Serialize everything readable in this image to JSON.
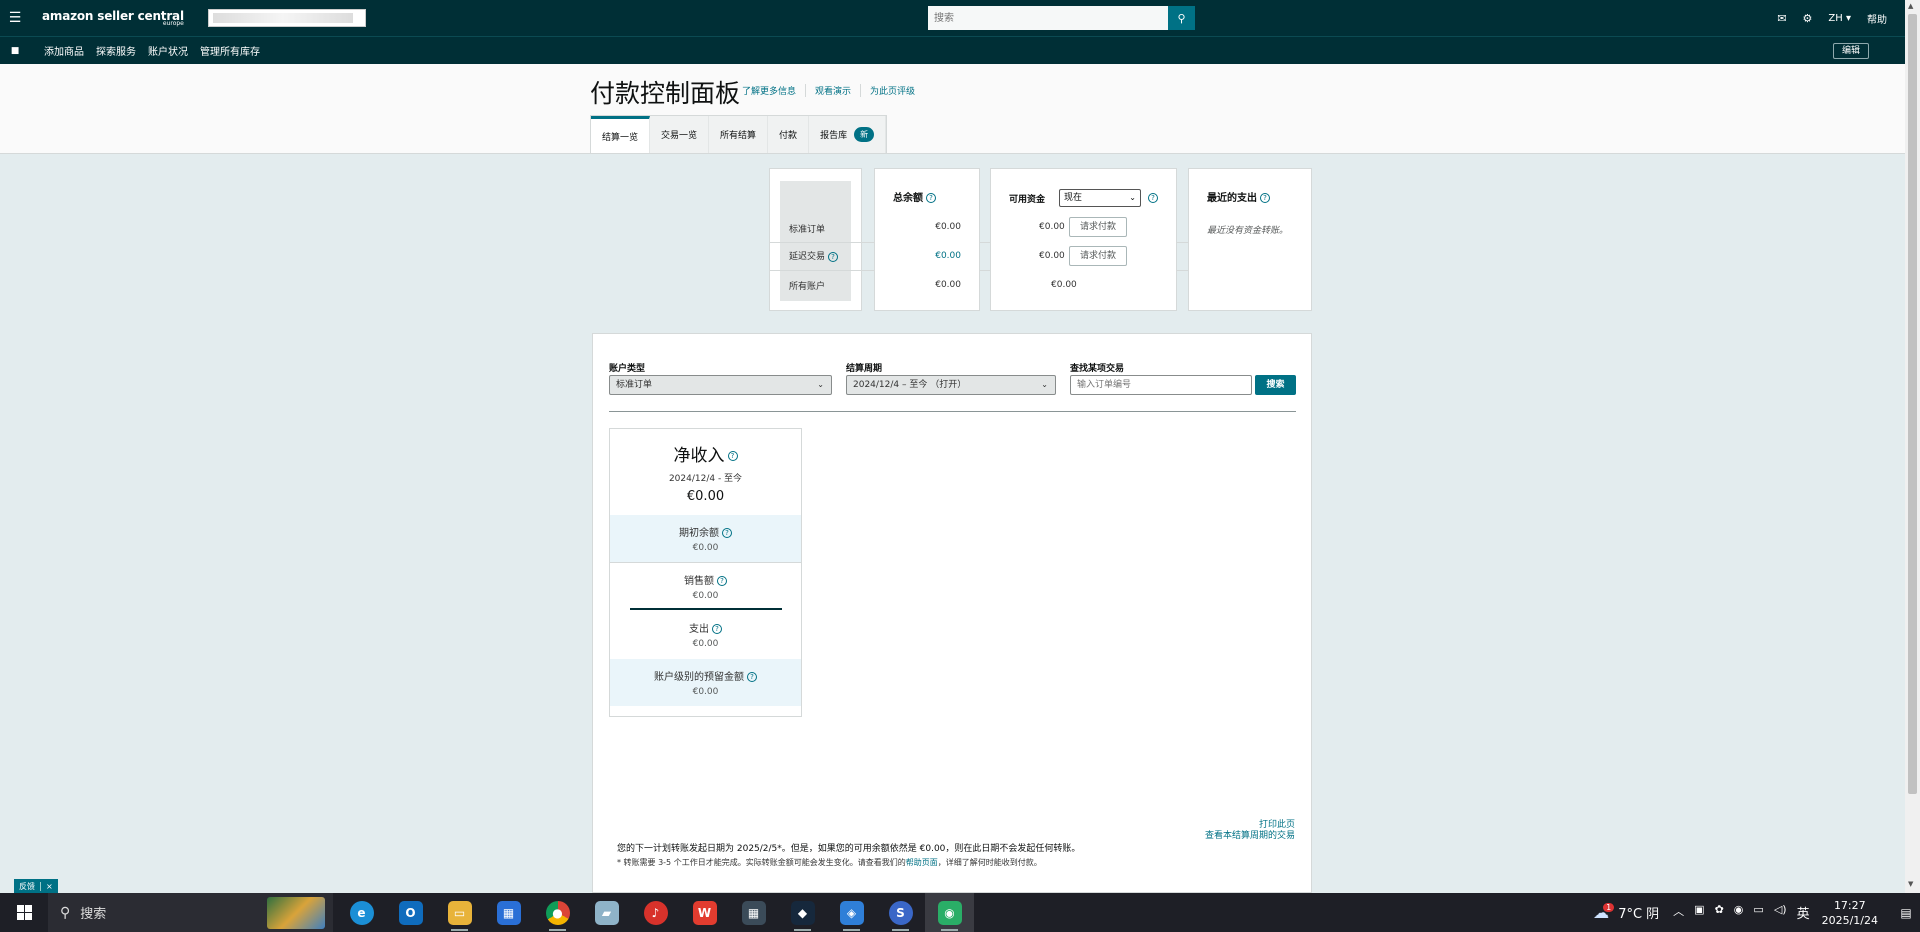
{
  "topbar": {
    "logo_main": "amazon seller central",
    "logo_sub": "europe",
    "search_placeholder": "搜索",
    "lang": "ZH ▾",
    "help": "帮助"
  },
  "nav": {
    "items": [
      "添加商品",
      "探索服务",
      "账户状况",
      "管理所有库存"
    ],
    "edit": "编辑"
  },
  "header": {
    "title": "付款控制面板",
    "links": [
      "了解更多信息",
      "观看演示",
      "为此页评级"
    ],
    "tabs": [
      "结算一览",
      "交易一览",
      "所有结算",
      "付款",
      "报告库"
    ],
    "badge": "新"
  },
  "summary": {
    "row_labels": [
      "标准订单",
      "延迟交易",
      "所有账户"
    ],
    "total": {
      "title": "总余额",
      "values": [
        "€0.00",
        "€0.00",
        "€0.00"
      ]
    },
    "available": {
      "title": "可用资金",
      "period": "现在",
      "values": [
        "€0.00",
        "€0.00",
        "€0.00"
      ],
      "request_label": "请求付款"
    },
    "recent": {
      "title": "最近的支出",
      "empty": "最近没有资金转账。"
    }
  },
  "filters": {
    "account_type_label": "账户类型",
    "account_type_value": "标准订单",
    "period_label": "结算周期",
    "period_value": "2024/12/4 – 至今 （打开）",
    "find_label": "查找某项交易",
    "find_placeholder": "输入订单编号",
    "search_button": "搜索"
  },
  "net": {
    "title": "净收入",
    "range": "2024/12/4 - 至今",
    "total": "€0.00",
    "rows": [
      {
        "label": "期初余额",
        "value": "€0.00"
      },
      {
        "label": "销售额",
        "value": "€0.00"
      },
      {
        "label": "支出",
        "value": "€0.00"
      },
      {
        "label": "账户级别的预留金额",
        "value": "€0.00"
      }
    ]
  },
  "footer": {
    "print": "打印此页",
    "view_txn": "查看本结算周期的交易",
    "note1": "您的下一计划转账发起日期为 2025/2/5*。但是，如果您的可用余额依然是 €0.00，则在此日期不会发起任何转账。",
    "note2_pre": "* 转账需要 3-5 个工作日才能完成。实际转账金额可能会发生变化。请查看我们的",
    "note2_link": "帮助页面",
    "note2_post": "，详细了解何时能收到付款。",
    "feedback": "反馈",
    "close": "×"
  },
  "taskbar": {
    "search": "搜索",
    "weather": "7°C  阴",
    "weather_badge": "1",
    "ime": "英",
    "time": "17:27",
    "date": "2025/1/24"
  },
  "colors": {
    "brand_dark": "#002f36",
    "accent": "#007185",
    "page_bg": "#e3ecee"
  }
}
